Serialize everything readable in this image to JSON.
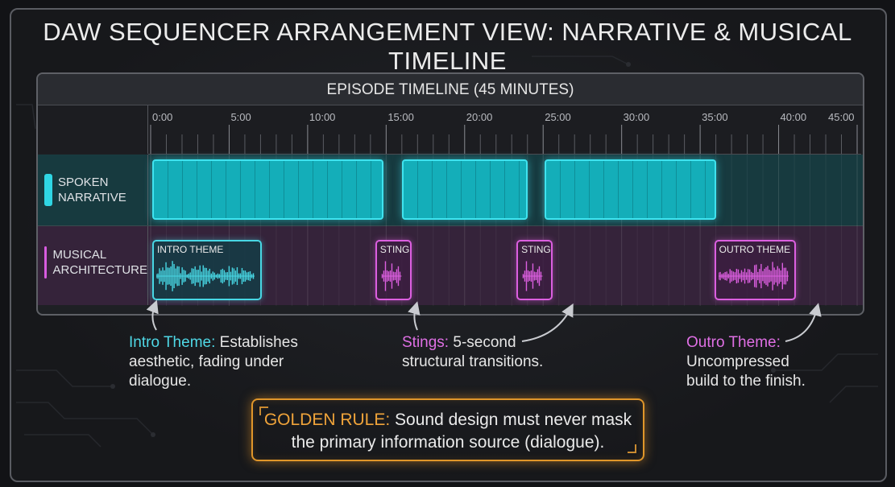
{
  "title": "DAW SEQUENCER ARRANGEMENT VIEW: NARRATIVE & MUSICAL TIMELINE",
  "timeline": {
    "header": "EPISODE TIMELINE (45 MINUTES)",
    "ticks": [
      "0:00",
      "5:00",
      "10:00",
      "15:00",
      "20:00",
      "25:00",
      "30:00",
      "35:00",
      "40:00",
      "45:00"
    ],
    "tick_minutes": [
      0,
      5,
      10,
      15,
      20,
      25,
      30,
      35,
      40,
      45
    ],
    "total_minutes": 45
  },
  "tracks": {
    "narrative": {
      "label_line1": "SPOKEN",
      "label_line2": "NARRATIVE",
      "color": "#2fd6e4",
      "clips_minutes": [
        [
          0.1,
          14.6
        ],
        [
          16.0,
          23.8
        ],
        [
          25.1,
          35.8
        ]
      ]
    },
    "music": {
      "label_line1": "MUSICAL",
      "label_line2": "ARCHITECTURE",
      "color": "#d85be0",
      "clips": [
        {
          "name": "INTRO THEME",
          "start": 0.1,
          "end": 6.9,
          "color": "#48d7e4"
        },
        {
          "name": "STING",
          "start": 14.3,
          "end": 16.4,
          "color": "#dc5fe0"
        },
        {
          "name": "STING",
          "start": 23.3,
          "end": 25.4,
          "color": "#dc5fe0"
        },
        {
          "name": "OUTRO THEME",
          "start": 35.9,
          "end": 40.9,
          "color": "#dc5fe0"
        }
      ]
    }
  },
  "annotations": {
    "intro": {
      "key": "Intro Theme:",
      "line1_rest": " Establishes",
      "line2": "aesthetic, fading under",
      "line3": "dialogue."
    },
    "stings": {
      "key": "Stings:",
      "line1_rest": " 5-second",
      "line2": "structural transitions."
    },
    "outro": {
      "key": "Outro Theme:",
      "line2": "Uncompressed",
      "line3": "build to the finish."
    }
  },
  "golden_rule": {
    "key": "GOLDEN RULE:",
    "line1_rest": " Sound design must never mask",
    "line2": "the primary information source (dialogue)."
  },
  "colors": {
    "cyan": "#4fd8e6",
    "pink": "#df6fe4",
    "orange": "#f0a43a"
  }
}
